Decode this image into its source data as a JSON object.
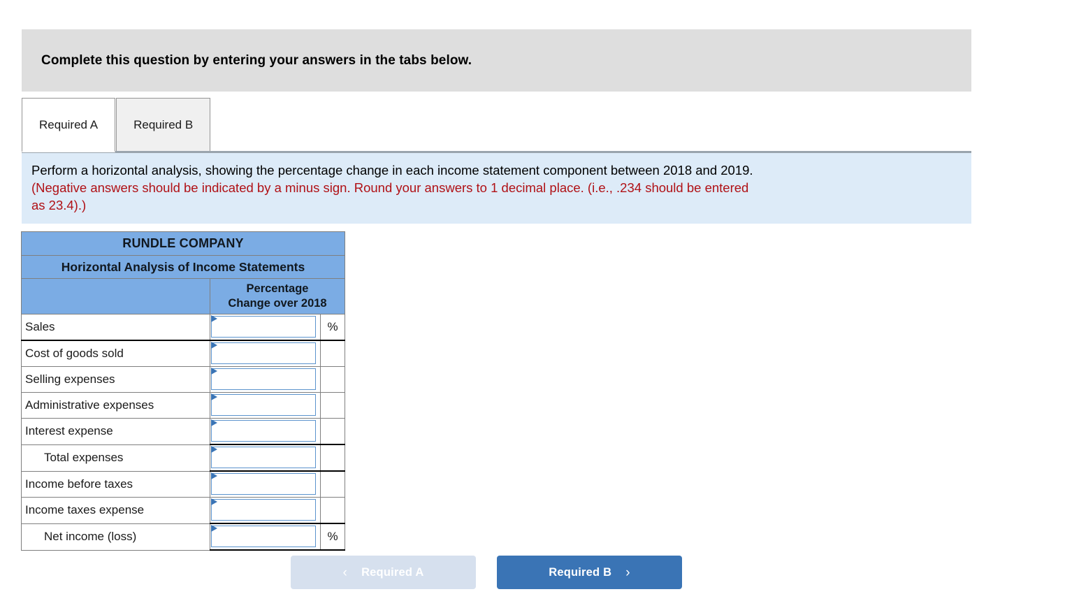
{
  "banner": {
    "text": "Complete this question by entering your answers in the tabs below."
  },
  "tabs": [
    {
      "label": "Required A",
      "active": true
    },
    {
      "label": "Required B",
      "active": false
    }
  ],
  "instructions": {
    "line1": "Perform a horizontal analysis, showing the percentage change in each income statement component between 2018 and 2019.",
    "line2_red": "(Negative answers should be indicated by a minus sign. Round your answers to 1 decimal place. (i.e., .234 should be entered",
    "line3_red": "as 23.4).)"
  },
  "table": {
    "company": "RUNDLE COMPANY",
    "subtitle": "Horizontal Analysis of Income Statements",
    "column_header_line1": "Percentage",
    "column_header_line2": "Change over 2018",
    "rows": [
      {
        "label": "Sales",
        "indent": false,
        "value": "",
        "pct": "%",
        "rule_bottom": true
      },
      {
        "label": "Cost of goods sold",
        "indent": false,
        "value": "",
        "pct": "",
        "rule_bottom": false
      },
      {
        "label": "Selling expenses",
        "indent": false,
        "value": "",
        "pct": "",
        "rule_bottom": false
      },
      {
        "label": "Administrative expenses",
        "indent": false,
        "value": "",
        "pct": "",
        "rule_bottom": false
      },
      {
        "label": "Interest expense",
        "indent": false,
        "value": "",
        "pct": "",
        "rule_bottom": true
      },
      {
        "label": "Total expenses",
        "indent": true,
        "value": "",
        "pct": "",
        "rule_bottom": true
      },
      {
        "label": "Income before taxes",
        "indent": false,
        "value": "",
        "pct": "",
        "rule_bottom": false
      },
      {
        "label": "Income taxes expense",
        "indent": false,
        "value": "",
        "pct": "",
        "rule_bottom": true
      },
      {
        "label": "Net income (loss)",
        "indent": true,
        "value": "",
        "pct": "%",
        "rule_bottom": true
      }
    ]
  },
  "footer": {
    "prev_label": "Required A",
    "next_label": "Required B",
    "prev_chevron": "‹",
    "next_chevron": "›"
  },
  "colors": {
    "banner_gray": "#dedede",
    "instruction_blue": "#ddebf8",
    "table_header_blue": "#7bace4",
    "input_border_blue": "#5b93cd",
    "accent_blue": "#3a74b5",
    "disabled_blue": "#d6e0ee",
    "warning_red": "#b01116"
  }
}
